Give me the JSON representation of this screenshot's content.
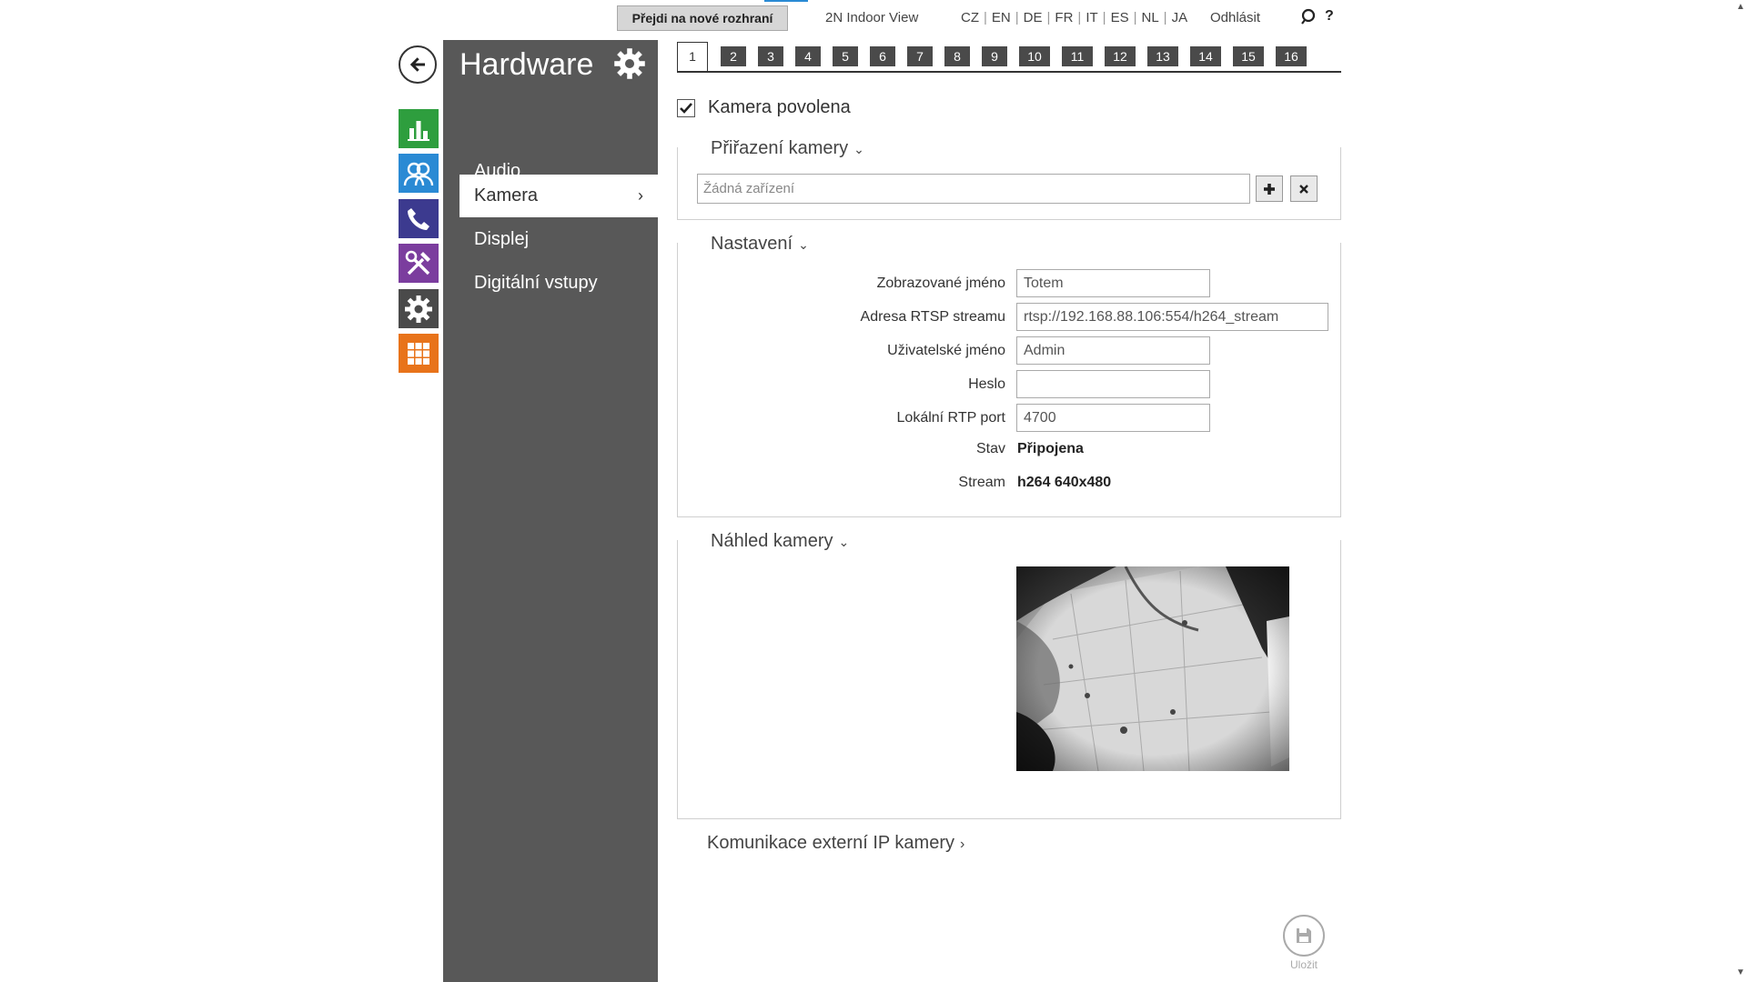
{
  "topbar": {
    "new_ui_button": "Přejdi na nové rozhraní",
    "indoor_view": "2N Indoor View",
    "languages": [
      "CZ",
      "EN",
      "DE",
      "FR",
      "IT",
      "ES",
      "NL",
      "JA"
    ],
    "logout": "Odhlásit",
    "help": "?"
  },
  "rail": {
    "icons": [
      "status-icon",
      "users-icon",
      "phone-icon",
      "tools-icon",
      "settings-icon",
      "apps-icon"
    ],
    "colors": {
      "status": "#2e9e3e",
      "users": "#2a8ad4",
      "phone": "#3c3a8f",
      "tools": "#7b3d9e",
      "settings": "#4a4a4a",
      "apps": "#e8731a"
    }
  },
  "sidebar": {
    "title": "Hardware",
    "items": [
      {
        "label": "Audio",
        "active": false
      },
      {
        "label": "Kamera",
        "active": true
      },
      {
        "label": "Displej",
        "active": false
      },
      {
        "label": "Digitální vstupy",
        "active": false
      }
    ]
  },
  "tabs": [
    "1",
    "2",
    "3",
    "4",
    "5",
    "6",
    "7",
    "8",
    "9",
    "10",
    "11",
    "12",
    "13",
    "14",
    "15",
    "16"
  ],
  "active_tab": "1",
  "camera_enabled": {
    "label": "Kamera povolena",
    "checked": true
  },
  "assignment": {
    "title": "Přiřazení kamery",
    "placeholder": "Žádná zařízení"
  },
  "settings": {
    "title": "Nastavení",
    "display_name_label": "Zobrazované jméno",
    "display_name_value": "Totem",
    "rtsp_label": "Adresa RTSP streamu",
    "rtsp_value": "rtsp://192.168.88.106:554/h264_stream",
    "username_label": "Uživatelské jméno",
    "username_value": "Admin",
    "password_label": "Heslo",
    "password_value": "",
    "rtp_port_label": "Lokální RTP port",
    "rtp_port_value": "4700",
    "status_label": "Stav",
    "status_value": "Připojena",
    "stream_label": "Stream",
    "stream_value": "h264 640x480"
  },
  "preview": {
    "title": "Náhled kamery"
  },
  "external": {
    "title": "Komunikace externí IP kamery"
  },
  "save": {
    "label": "Uložit"
  }
}
